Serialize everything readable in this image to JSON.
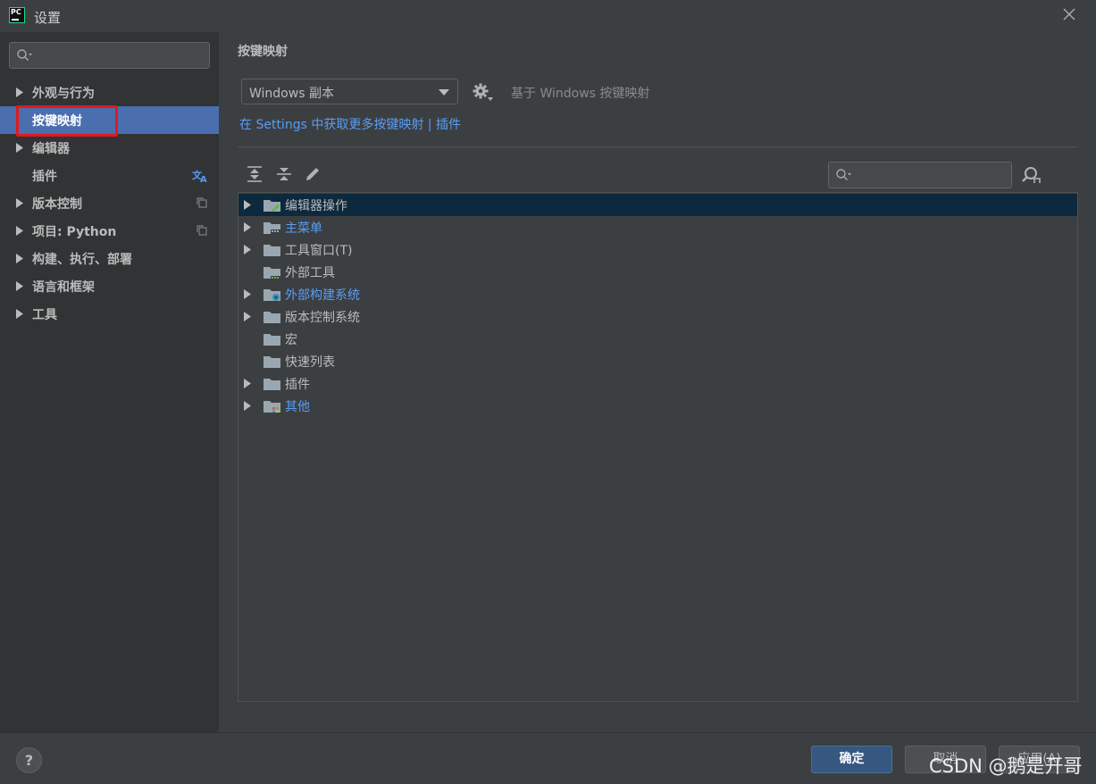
{
  "window": {
    "title": "设置"
  },
  "sidebar": {
    "search_placeholder": "",
    "items": [
      {
        "label": "外观与行为",
        "expandable": true
      },
      {
        "label": "按键映射",
        "expandable": false,
        "selected": true
      },
      {
        "label": "编辑器",
        "expandable": true
      },
      {
        "label": "插件",
        "expandable": false,
        "badge": "translate-icon"
      },
      {
        "label": "版本控制",
        "expandable": true,
        "badge": "copy-icon"
      },
      {
        "label": "项目: Python",
        "expandable": true,
        "badge": "copy-icon"
      },
      {
        "label": "构建、执行、部署",
        "expandable": true
      },
      {
        "label": "语言和框架",
        "expandable": true
      },
      {
        "label": "工具",
        "expandable": true
      }
    ]
  },
  "main": {
    "title": "按键映射",
    "keymap_value": "Windows 副本",
    "based_on": "基于 Windows 按键映射",
    "link_text": "在 Settings 中获取更多按键映射 | 插件",
    "tree_search_placeholder": "",
    "tree": [
      {
        "label": "编辑器操作",
        "expandable": true,
        "selected": true,
        "color": "normal",
        "icon": "folder-edit-icon"
      },
      {
        "label": "主菜单",
        "expandable": true,
        "color": "blue",
        "icon": "folder-menu-icon"
      },
      {
        "label": "工具窗口(T)",
        "expandable": true,
        "color": "normal",
        "icon": "folder-icon"
      },
      {
        "label": "外部工具",
        "expandable": false,
        "color": "normal",
        "icon": "folder-external-icon"
      },
      {
        "label": "外部构建系统",
        "expandable": true,
        "color": "blue",
        "icon": "folder-gear-icon"
      },
      {
        "label": "版本控制系统",
        "expandable": true,
        "color": "normal",
        "icon": "folder-icon"
      },
      {
        "label": "宏",
        "expandable": false,
        "color": "normal",
        "icon": "folder-icon"
      },
      {
        "label": "快速列表",
        "expandable": false,
        "color": "normal",
        "icon": "folder-icon"
      },
      {
        "label": "插件",
        "expandable": true,
        "color": "normal",
        "icon": "folder-icon"
      },
      {
        "label": "其他",
        "expandable": true,
        "color": "blue",
        "icon": "folder-other-icon"
      }
    ]
  },
  "footer": {
    "help": "?",
    "ok": "确定",
    "cancel": "取消",
    "apply": "应用(A)"
  },
  "watermark": "CSDN @鹅是开哥",
  "colors": {
    "selected_nav": "#4b6eaf",
    "link": "#589df6",
    "highlight_box": "#e0191f",
    "selected_tree_row": "#0d293e"
  }
}
